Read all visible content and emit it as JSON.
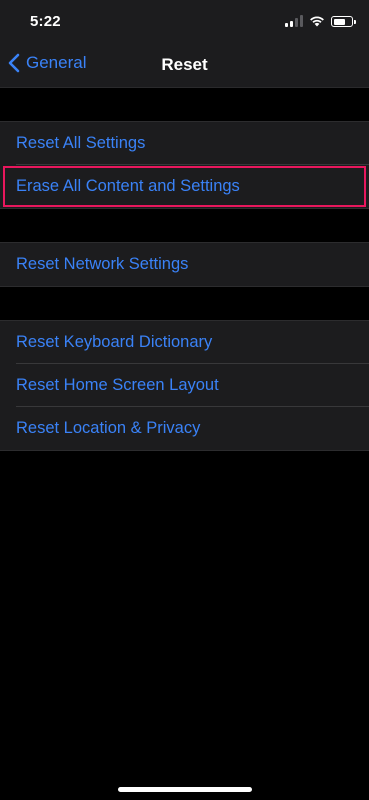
{
  "status_bar": {
    "time": "5:22"
  },
  "nav": {
    "back_label": "General",
    "title": "Reset"
  },
  "groups": [
    {
      "items": [
        {
          "label": "Reset All Settings"
        },
        {
          "label": "Erase All Content and Settings",
          "highlighted": true
        }
      ]
    },
    {
      "items": [
        {
          "label": "Reset Network Settings"
        }
      ]
    },
    {
      "items": [
        {
          "label": "Reset Keyboard Dictionary"
        },
        {
          "label": "Reset Home Screen Layout"
        },
        {
          "label": "Reset Location & Privacy"
        }
      ]
    }
  ],
  "colors": {
    "accent": "#3a82f7",
    "highlight_border": "#e8175d",
    "background": "#000000",
    "cell_background": "#1c1c1e"
  },
  "icons": [
    "signal-icon",
    "wifi-icon",
    "battery-icon",
    "chevron-left-icon"
  ]
}
